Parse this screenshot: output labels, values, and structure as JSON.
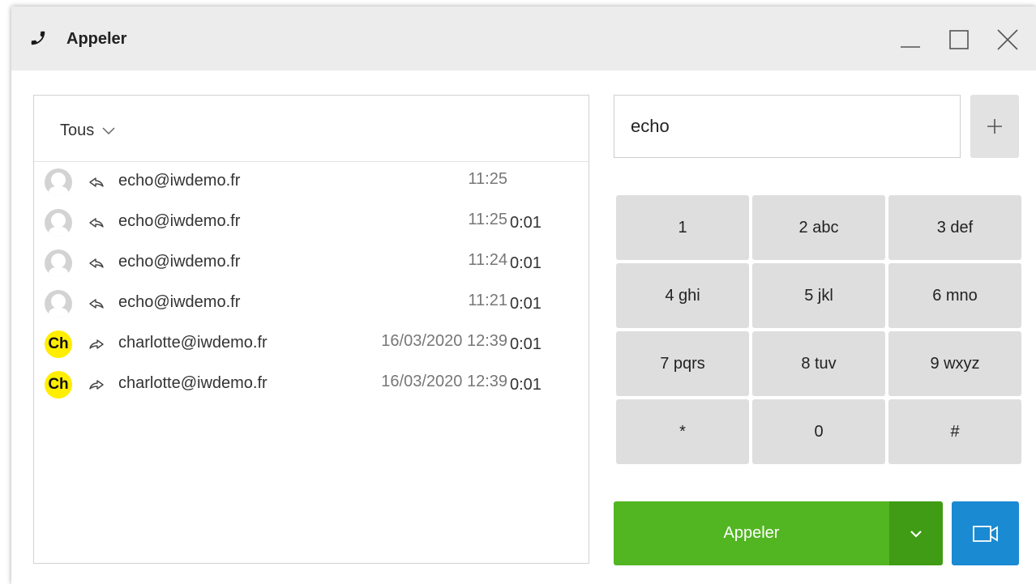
{
  "window": {
    "title": "Appeler",
    "icons": {
      "title": "phone-icon",
      "minimize": "minimize-icon",
      "maximize": "maximize-icon",
      "close": "close-icon"
    }
  },
  "history": {
    "filter_label": "Tous",
    "rows": [
      {
        "avatar": "",
        "direction": "incoming",
        "contact": "echo@iwdemo.fr",
        "when": "11:25",
        "duration": ""
      },
      {
        "avatar": "",
        "direction": "incoming",
        "contact": "echo@iwdemo.fr",
        "when": "11:25",
        "duration": "0:01"
      },
      {
        "avatar": "",
        "direction": "incoming",
        "contact": "echo@iwdemo.fr",
        "when": "11:24",
        "duration": "0:01"
      },
      {
        "avatar": "",
        "direction": "incoming",
        "contact": "echo@iwdemo.fr",
        "when": "11:21",
        "duration": "0:01"
      },
      {
        "avatar": "Ch",
        "direction": "outgoing",
        "contact": "charlotte@iwdemo.fr",
        "when": "16/03/2020 12:39",
        "duration": "0:01"
      },
      {
        "avatar": "Ch",
        "direction": "outgoing",
        "contact": "charlotte@iwdemo.fr",
        "when": "16/03/2020 12:39",
        "duration": "0:01"
      }
    ]
  },
  "dialer": {
    "number_value": "echo",
    "add_label": "+",
    "keys": [
      "1",
      "2 abc",
      "3 def",
      "4 ghi",
      "5 jkl",
      "6 mno",
      "7 pqrs",
      "8 tuv",
      "9 wxyz",
      "*",
      "0",
      "#"
    ],
    "call_label": "Appeler",
    "icons": {
      "dropdown": "chevron-down-icon",
      "video": "video-camera-icon"
    }
  },
  "colors": {
    "call_green": "#52b522",
    "call_green_dark": "#3f9c14",
    "video_blue": "#1a8ad2",
    "initials_yellow": "#ffee00",
    "key_gray": "#dedede",
    "titlebar_gray": "#ececec"
  }
}
